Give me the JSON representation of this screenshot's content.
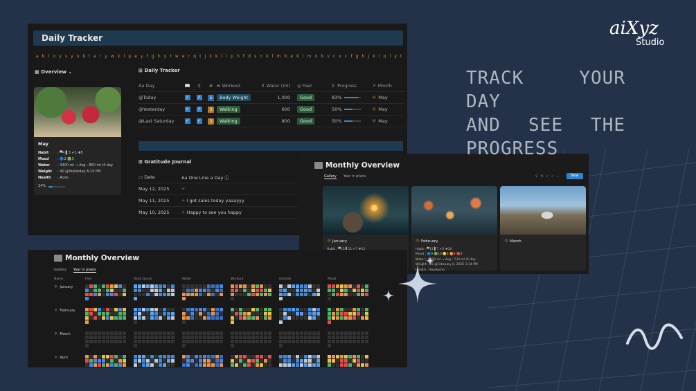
{
  "headline": {
    "line1": "TRACK YOUR DAY",
    "line2": "AND SEE THE",
    "line3": "PROGRESS"
  },
  "logo": {
    "line1": "aiXyz",
    "line2": "Studio"
  },
  "daily": {
    "title": "Daily Tracker",
    "alphabet": "a b l o y s y o k l a r y w k l p e y f g h y t w e r q t j k k l l p h f d s n k l m b e k l m n b v c x c f g h j k l p l y t r e w q g b n m k l h f d g v b n m j h g f d s a y t",
    "overview": {
      "label": "Overview",
      "card": {
        "month": "May",
        "habit_label": "Habit",
        "habit_value": ": ▀4 ▌3 ✔1 ✚5",
        "mood_label": "Mood",
        "mood_value": ": 🔵2 🟢3",
        "water_label": "Water",
        "water_value": ": 3400 ml → Avg : 850 ml /4 day",
        "weight_label": "Weight",
        "weight_value": ": 40 @Yesterday 6:15 PM",
        "health_label": "Health",
        "health_value": ": Acne",
        "progress_text": "24%",
        "progress": 0.24
      }
    },
    "table": {
      "title": "Daily Tracker",
      "headers": {
        "day": "Day",
        "workout": "Workout",
        "water": "Water (ml)",
        "feel": "Feel",
        "progress": "Progress",
        "month": "Month"
      },
      "rows": [
        {
          "day": "@Today",
          "num": "5",
          "workout": "Body Weight",
          "water": "1,000",
          "feel": "Good",
          "progress_text": "83%",
          "progress": 0.83,
          "month": "May"
        },
        {
          "day": "@Yesterday",
          "num": "3",
          "workout": "Walking",
          "water": "600",
          "feel": "Good",
          "progress_text": "50%",
          "progress": 0.5,
          "month": "May"
        },
        {
          "day": "@Last Saturday",
          "num": "3",
          "workout": "Walking",
          "water": "800",
          "feel": "Good",
          "progress_text": "50%",
          "progress": 0.5,
          "month": "May"
        }
      ]
    },
    "gratitude": {
      "title": "Gratitude Journal",
      "headers": {
        "date": "Date",
        "line": "One Line a Day"
      },
      "rows": [
        {
          "date": "May 12, 2025",
          "text": ""
        },
        {
          "date": "May 11, 2025",
          "text": "I got sales today yaaayyy"
        },
        {
          "date": "May 10, 2025",
          "text": "Happy to see you happy"
        }
      ]
    }
  },
  "monthly_gallery": {
    "title": "Monthly Overview",
    "tab_gallery": "Gallery",
    "tab_year": "Year in pixels",
    "new_button": "New",
    "cards": [
      {
        "month": "January",
        "habit": "Habit : ▀13 ▌11 ✔7 ✚12",
        "mood": "Mood : 🔵6 🟢10 🟡7 🟠6 🔴4",
        "water": "Water : 8200 ml → Avg : 360 ml /7 day",
        "weight": "Weight : 35 @January 27, 2025 8:04 AM",
        "health": "Health : Headache"
      },
      {
        "month": "February",
        "habit": "Habit : ▀13 ▌7 ✔5 ✚10",
        "mood": "Mood : 🔵9 🟢10 🟡4 🟠4 🔴3",
        "water": "Water : 4400 ml → Avg : 733 ml /6 day",
        "weight": "Weight : 35 @February 6, 2025 3:34 PM",
        "health": "Health : Headache"
      },
      {
        "month": "March"
      }
    ]
  },
  "year_pixels": {
    "title": "Monthly Overview",
    "tab_gallery": "Gallery",
    "tab_year": "Year in pixels",
    "columns": [
      "Name",
      "Feel",
      "Read Quran",
      "Water",
      "Workout",
      "Outside",
      "Mood"
    ],
    "months": [
      "January",
      "February",
      "March",
      "April"
    ]
  },
  "colors": {
    "accent": "#2f82d1",
    "background": "#233249",
    "panel": "#191919",
    "tag_green": "#2c5b3c"
  }
}
